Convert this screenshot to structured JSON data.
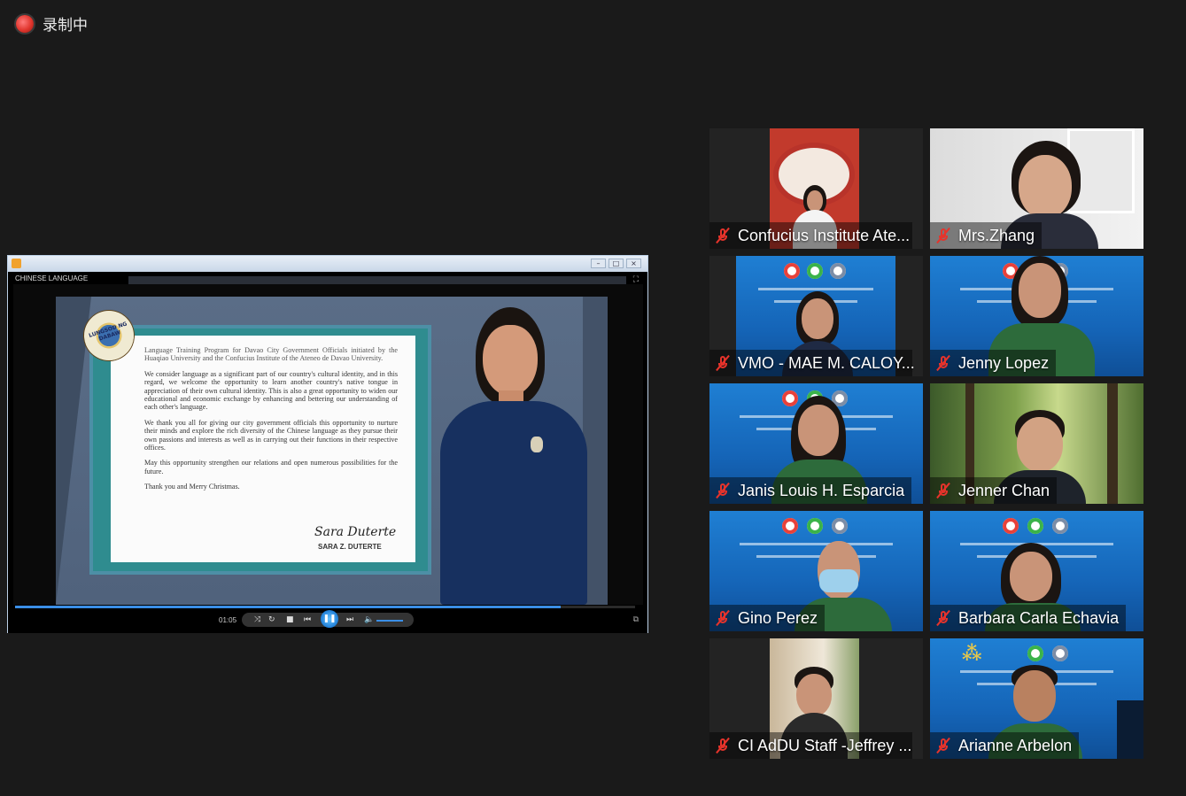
{
  "recording": {
    "label": "录制中",
    "icon": "recording-dot-icon",
    "color": "#e0352d"
  },
  "share": {
    "video_title": "CHINESE LANGUAGE",
    "letter": {
      "intro": "Language Training Program for Davao City Government Officials initiated by the Huaqiao University and the Confucius Institute of the Ateneo de Davao University.",
      "p1": "We consider language as a significant part of our country's cultural identity, and in this regard, we welcome the opportunity to learn another country's native tongue in appreciation of their own cultural identity. This is also a great opportunity to widen our educational and economic exchange by enhancing and bettering our understanding of each other's language.",
      "p2": "We thank you all for giving our city government officials this opportunity to nurture their minds and explore the rich diversity of the Chinese language as they pursue their own passions and interests as well as in carrying out their functions in their respective offices.",
      "p3": "May this opportunity strengthen our relations and open numerous possibilities for the future.",
      "closing": "Thank you and Merry Christmas.",
      "signature": "Sara Duterte",
      "signatory": "SARA Z. DUTERTE",
      "seal_text": "LUNGSOD NG DABAW"
    },
    "player": {
      "time": "01:05",
      "progress": 0.88,
      "accent": "#3a8ee6"
    }
  },
  "participants": [
    {
      "name": "Confucius Institute Ate...",
      "muted": true,
      "bg": "office"
    },
    {
      "name": "Mrs.Zhang",
      "muted": true,
      "bg": "room"
    },
    {
      "name": "VMO - MAE M. CALOY...",
      "muted": true,
      "bg": "banner"
    },
    {
      "name": "Jenny Lopez",
      "muted": true,
      "bg": "banner"
    },
    {
      "name": "Janis Louis H. Esparcia",
      "muted": true,
      "bg": "banner"
    },
    {
      "name": "Jenner Chan",
      "muted": true,
      "bg": "forest"
    },
    {
      "name": "Gino Perez",
      "muted": true,
      "bg": "banner"
    },
    {
      "name": "Barbara Carla Echavia",
      "muted": true,
      "bg": "banner"
    },
    {
      "name": "CI AdDU Staff -Jeffrey ...",
      "muted": true,
      "bg": "room"
    },
    {
      "name": "Arianne Arbelon",
      "muted": true,
      "bg": "banner"
    }
  ]
}
